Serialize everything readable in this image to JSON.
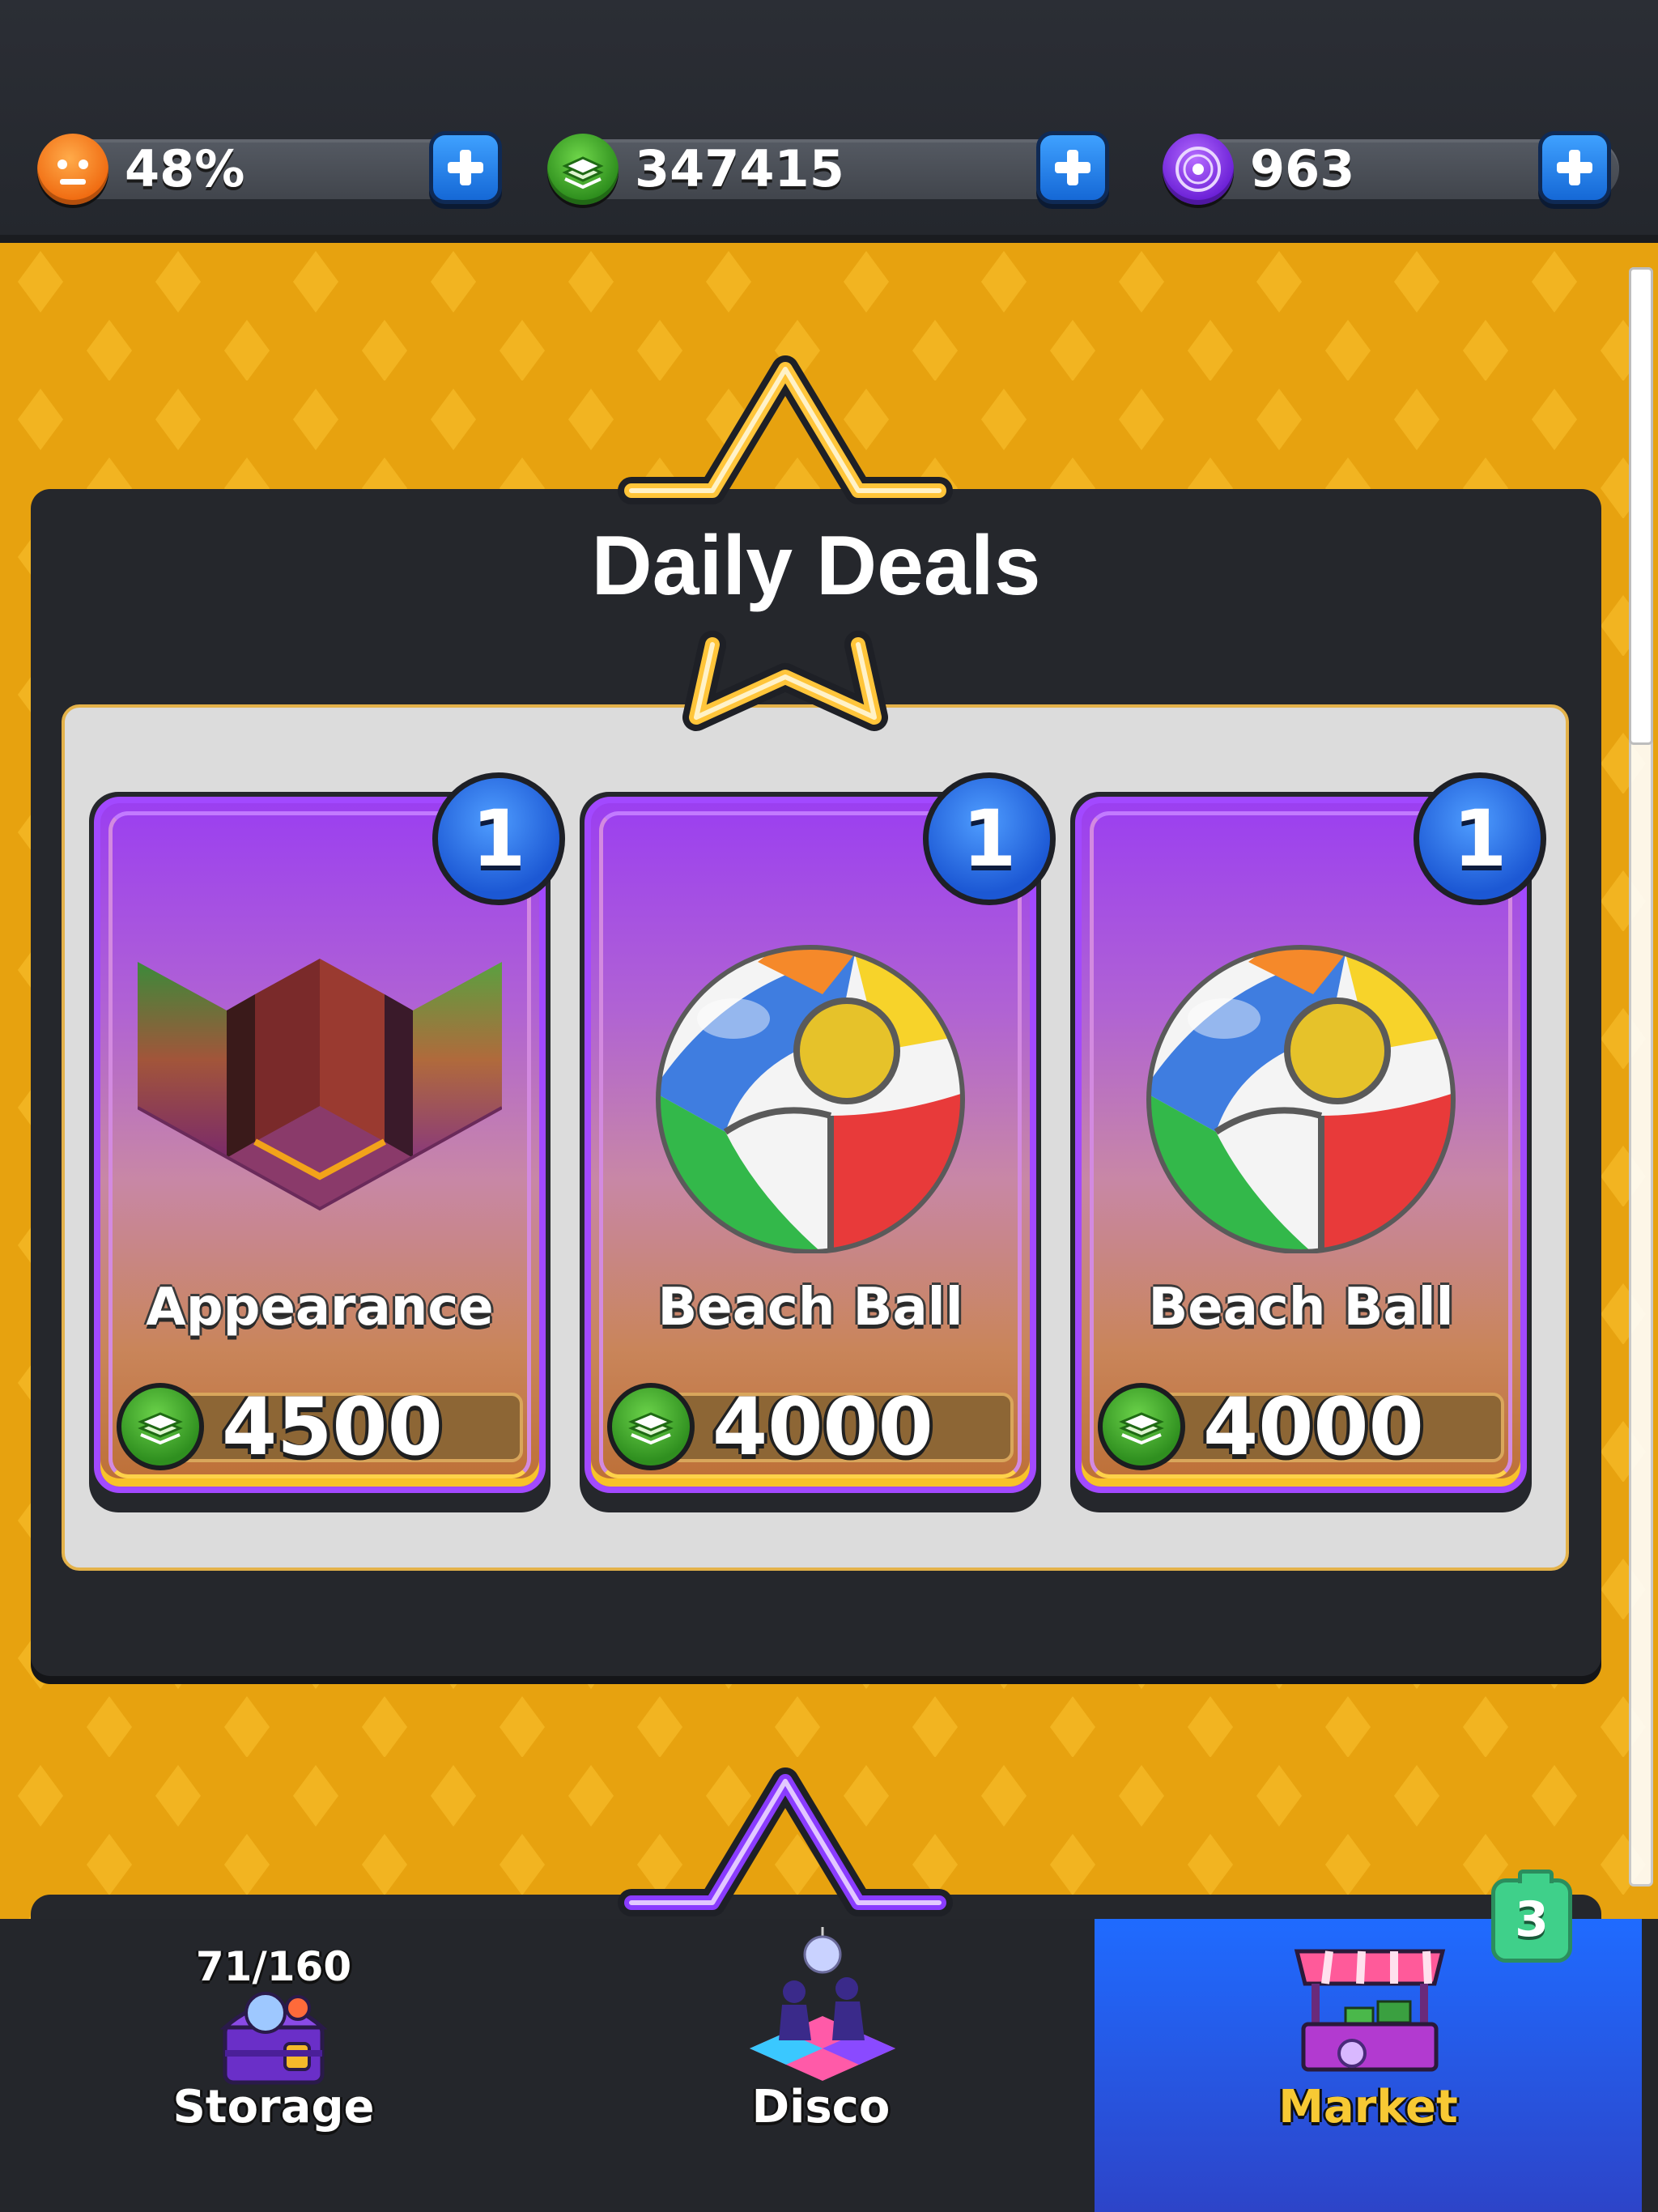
{
  "resources": {
    "happiness": {
      "value": "48%",
      "icon": "happy-face-icon",
      "color": "#ff7a1a"
    },
    "cash": {
      "value": "347415",
      "icon": "cash-stack-icon",
      "color": "#3cae2a"
    },
    "records": {
      "value": "963",
      "icon": "vinyl-record-icon",
      "color": "#8a33ff"
    }
  },
  "panel": {
    "title": "Daily Deals"
  },
  "deals": [
    {
      "name": "Appearance",
      "quantity": "1",
      "price": "4500",
      "image": "room-appearance-icon"
    },
    {
      "name": "Beach Ball",
      "quantity": "1",
      "price": "4000",
      "image": "beach-ball-icon"
    },
    {
      "name": "Beach Ball",
      "quantity": "1",
      "price": "4000",
      "image": "beach-ball-icon"
    }
  ],
  "nav": {
    "storage": {
      "label": "Storage",
      "count": "71/160",
      "icon": "treasure-chest-icon"
    },
    "disco": {
      "label": "Disco",
      "icon": "disco-dancers-icon"
    },
    "market": {
      "label": "Market",
      "badge": "3",
      "icon": "market-stall-icon",
      "active": true
    }
  },
  "colors": {
    "accent_gold": "#f8c22a",
    "card_purple": "#a249ff",
    "nav_active": "#1f6bff"
  }
}
